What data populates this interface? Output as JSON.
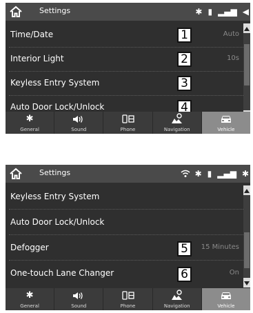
{
  "screens": [
    {
      "title": "Settings",
      "status_icons": [
        "bluetooth-icon",
        "phone-battery-icon",
        "signal-icon",
        "speaker-icon"
      ],
      "rows": [
        {
          "label": "Time/Date",
          "callout": "1",
          "value": "Auto"
        },
        {
          "label": "Interior Light",
          "callout": "2",
          "value": "10s"
        },
        {
          "label": "Keyless Entry System",
          "callout": "3",
          "value": ""
        },
        {
          "label": "Auto Door Lock/Unlock",
          "callout": "4",
          "value": ""
        }
      ],
      "scroll_position": 0.25
    },
    {
      "title": "Settings",
      "status_icons": [
        "wifi-icon",
        "bluetooth-icon",
        "phone-battery-icon",
        "signal-icon",
        "bluetooth-icon"
      ],
      "rows": [
        {
          "label": "Keyless Entry System",
          "callout": "",
          "value": ""
        },
        {
          "label": "Auto Door Lock/Unlock",
          "callout": "",
          "value": ""
        },
        {
          "label": "Defogger",
          "callout": "5",
          "value": "15 Minutes"
        },
        {
          "label": "One-touch Lane Changer",
          "callout": "6",
          "value": "On"
        }
      ],
      "scroll_position": 0.6
    }
  ],
  "tabs": [
    {
      "label": "General",
      "icon": "gear-icon"
    },
    {
      "label": "Sound",
      "icon": "speaker-icon"
    },
    {
      "label": "Phone",
      "icon": "phone-icon"
    },
    {
      "label": "Navigation",
      "icon": "navigation-icon"
    },
    {
      "label": "Vehicle",
      "icon": "car-icon"
    }
  ],
  "active_tab": "Vehicle",
  "colors": {
    "background": "#2f2f2f",
    "status_bar": "#4a4a4a",
    "tab_bar": "#3b3b3b",
    "active_tab": "#8c8c8c",
    "value_text": "#8a8a8a"
  }
}
